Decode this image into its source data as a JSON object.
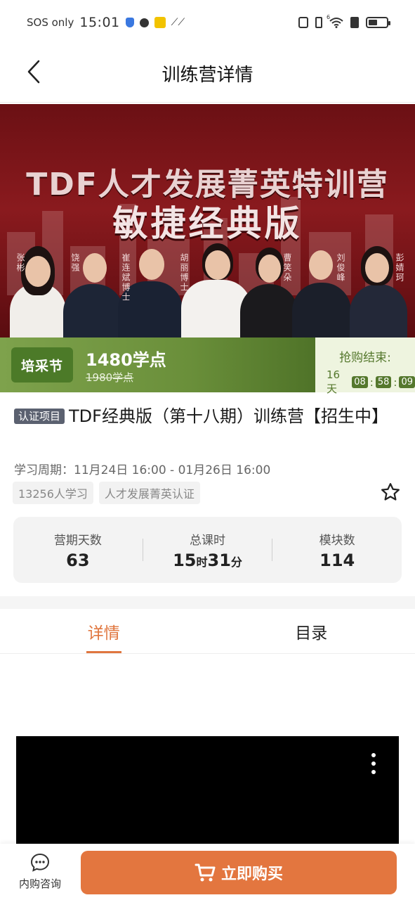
{
  "status_bar": {
    "carrier": "SOS only",
    "time": "15:01",
    "signal_label": "6"
  },
  "nav": {
    "title": "训练营详情"
  },
  "banner": {
    "title_line1": "TDF人才发展菁英特训营",
    "title_line2": "敏捷经典版",
    "speakers": [
      {
        "name": "张彬"
      },
      {
        "name": "饶强"
      },
      {
        "name": "崔连斌博士"
      },
      {
        "name": "胡丽博士"
      },
      {
        "name": "曹笑朵"
      },
      {
        "name": "刘俊峰"
      },
      {
        "name": "彭婧珂"
      }
    ]
  },
  "price": {
    "promo_badge": "培采节",
    "current": "1480学点",
    "original": "1980学点",
    "countdown_title": "抢购结束:",
    "countdown_days": "16天",
    "countdown_h": "08",
    "countdown_m": "58",
    "countdown_s": "09",
    "countdown_sep": ":"
  },
  "course": {
    "cert_tag": "认证项目",
    "title": "TDF经典版（第十八期）训练营【招生中】",
    "period": "学习周期：11月24日 16:00 - 01月26日 16:00",
    "learners_tag": "13256人学习",
    "category_tag": "人才发展菁英认证"
  },
  "stats": {
    "days_label": "营期天数",
    "days_value": "63",
    "hours_label": "总课时",
    "hours_h": "15",
    "hours_h_unit": "时",
    "hours_m": "31",
    "hours_m_unit": "分",
    "modules_label": "模块数",
    "modules_value": "114"
  },
  "tabs": [
    {
      "label": "详情",
      "active": true
    },
    {
      "label": "目录",
      "active": false
    }
  ],
  "bottom": {
    "consult_label": "内购咨询",
    "buy_label": "立即购买"
  },
  "colors": {
    "accent": "#e3763f",
    "promo_green": "#6a8f3a",
    "banner_red": "#7a1418"
  },
  "icons": [
    "back-arrow-icon",
    "star-icon",
    "chat-icon",
    "cart-icon",
    "more-vertical-icon"
  ]
}
